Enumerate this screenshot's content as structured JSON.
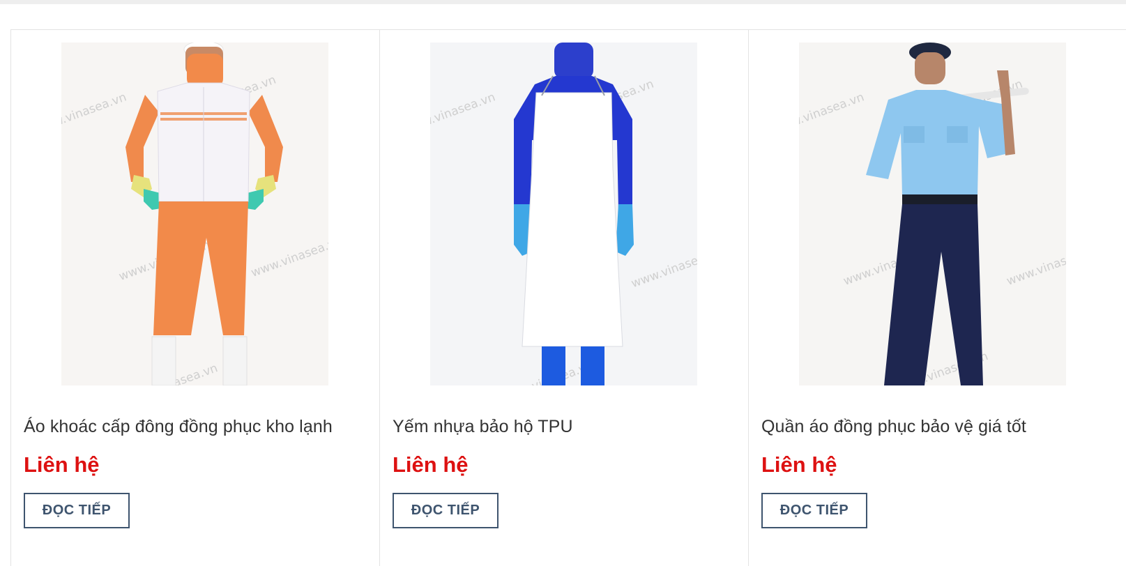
{
  "products": [
    {
      "title": "Áo khoác cấp đông đồng phục kho lạnh",
      "price": "Liên hệ",
      "button_label": "ĐỌC TIẾP",
      "image_icon": "cold-storage-uniform-image",
      "watermark": "www.vinasea.vn"
    },
    {
      "title": "Yếm nhựa bảo hộ TPU",
      "price": "Liên hệ",
      "button_label": "ĐỌC TIẾP",
      "image_icon": "tpu-apron-image",
      "watermark": "www.vinasea.vn"
    },
    {
      "title": "Quần áo đồng phục bảo vệ giá tốt",
      "price": "Liên hệ",
      "button_label": "ĐỌC TIẾP",
      "image_icon": "security-uniform-image",
      "watermark": "www.vinasea.vn"
    }
  ],
  "colors": {
    "price": "#dd1111",
    "button_border": "#3e546e",
    "title": "#333333"
  }
}
